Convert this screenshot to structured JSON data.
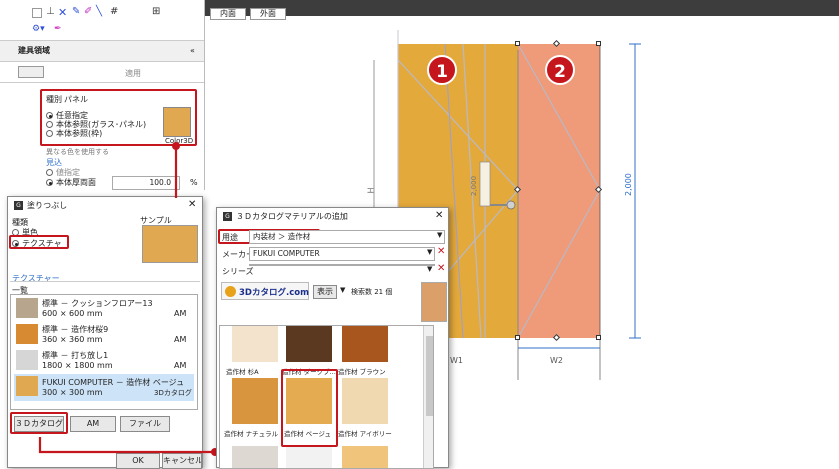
{
  "canvas": {
    "tabs": [
      {
        "label": "内面"
      },
      {
        "label": "外面"
      }
    ],
    "dim_left": "H",
    "dim_right": "2,000",
    "dim_center": "2,000",
    "dim_w1": "W1",
    "dim_w2": "W2",
    "badges": [
      "1",
      "2"
    ],
    "colors": {
      "panel1": "#e4a93b",
      "panel2": "#ef9a78",
      "accent": "#c4161c",
      "dim_line": "#2f6fc8"
    }
  },
  "left_panel": {
    "section_title": "建具領域",
    "apply_label": "適用",
    "group_label": "種別",
    "group_value": "パネル",
    "options": [
      "任意指定",
      "本体参照(ガラス･パネル)",
      "本体参照(枠)"
    ],
    "color_button": "Color3D",
    "partial_text": "異なる色を使用する",
    "mikomi_label": "見込",
    "mikomi_options": [
      "値指定",
      "本体厚両面"
    ],
    "value": "100.0",
    "unit": "%"
  },
  "paint_dialog": {
    "title": "塗りつぶし",
    "kind_label": "種類",
    "kind_options": [
      "単色",
      "テクスチャ"
    ],
    "sample_label": "サンプル",
    "texture_label": "テクスチャー",
    "list_label": "一覧",
    "items": [
      {
        "name": "標準 － クッションフロアー13",
        "size": "600 × 600 mm",
        "src": "AM"
      },
      {
        "name": "標準 － 造作材桜9",
        "size": "360 × 360 mm",
        "src": "AM"
      },
      {
        "name": "標準 － 打ち放し1",
        "size": "1800 × 1800 mm",
        "src": "AM"
      },
      {
        "name": "FUKUI COMPUTER － 造作材 ベージュ",
        "size": "300 × 300 mm",
        "src": "3Dカタログ"
      }
    ],
    "buttons": {
      "catalog": "３Ｄカタログ",
      "am": "AM",
      "file": "ファイル",
      "ok": "OK",
      "cancel": "キャンセル"
    }
  },
  "catalog_dialog": {
    "title": "３Ｄカタログマテリアルの追加",
    "use_label": "用途",
    "use_value": "内装材 ＞ 造作材",
    "maker_label": "メーカー",
    "maker_value": "FUKUI COMPUTER",
    "series_label": "シリーズ",
    "series_value": "",
    "logo": "3Dカタログ.com",
    "display_label": "表示",
    "count_label": "検索数 21 個",
    "tiles": [
      {
        "label": "造作材 杉A",
        "color": "#f3e3cd"
      },
      {
        "label": "造作材 ダークブ...",
        "color": "#5a3920"
      },
      {
        "label": "造作材 ブラウン",
        "color": "#a9561e"
      },
      {
        "label": "造作材 ナチュラル",
        "color": "#d8953d"
      },
      {
        "label": "造作材 ベージュ",
        "color": "#e4ab51"
      },
      {
        "label": "造作材 アイボリー",
        "color": "#f0d8b0"
      }
    ]
  }
}
